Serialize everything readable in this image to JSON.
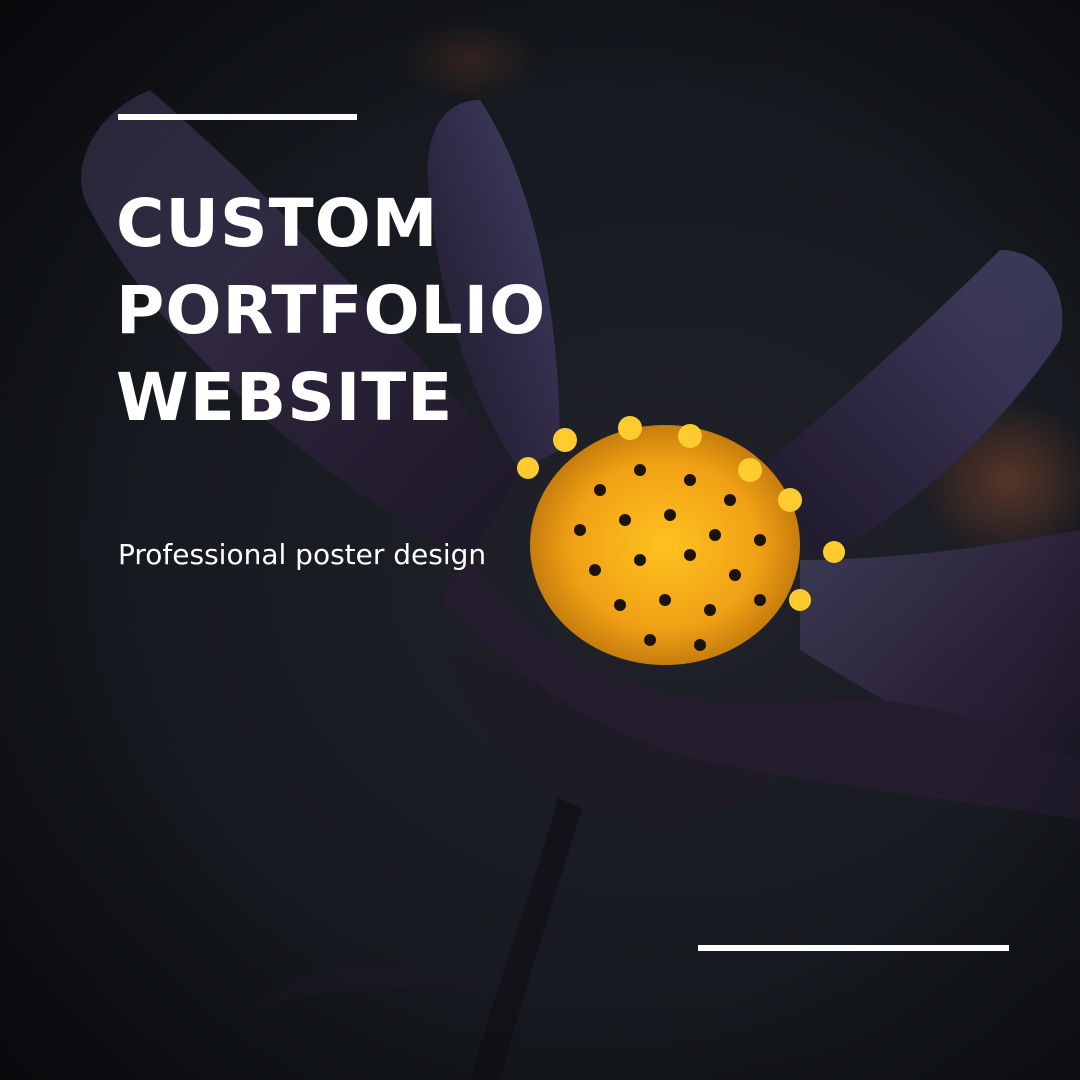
{
  "headline": {
    "line1": "CUSTOM",
    "line2": "PORTFOLIO",
    "line3": "WEBSITE"
  },
  "subtitle": "Professional poster design",
  "colors": {
    "background": "#14171c",
    "petal": "#2a2338",
    "petal_highlight": "#4a4266",
    "stamen": "#f2a81a",
    "text": "#ffffff"
  }
}
